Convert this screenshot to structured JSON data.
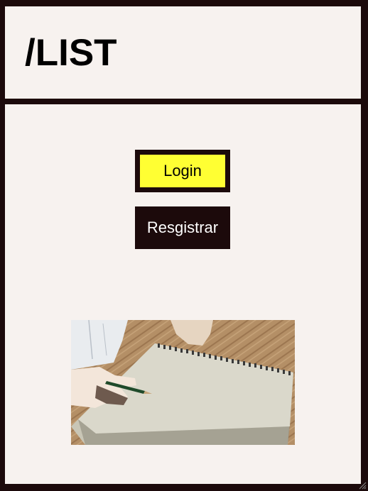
{
  "header": {
    "logo_text": "/LIST"
  },
  "actions": {
    "login_label": "Login",
    "register_label": "Resgistrar"
  },
  "illustration": {
    "icon": "sketchbook-drawing-illustration"
  },
  "colors": {
    "frame": "#1c0a0b",
    "background": "#f7f2ef",
    "login_bg": "#ffff33",
    "register_bg": "#1c0a0b"
  }
}
